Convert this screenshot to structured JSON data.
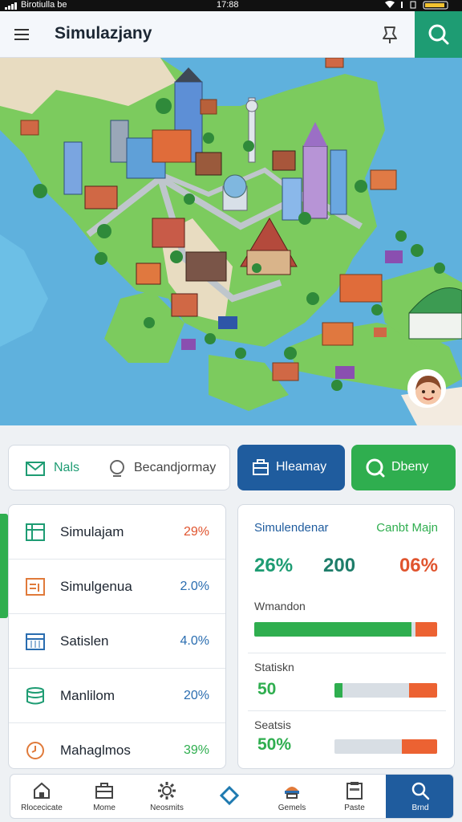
{
  "status_bar": {
    "carrier": "Birotiulla be",
    "time": "17:88"
  },
  "app_bar": {
    "title": "Simulazjany",
    "menu_icon": "menu-icon",
    "pin_icon": "pin-icon",
    "search_icon": "search-icon"
  },
  "actions": {
    "segment": {
      "left_label": "Nals",
      "left_icon": "mail-icon",
      "right_label": "Becandjormay",
      "right_icon": "search-icon"
    },
    "primary": {
      "label": "Hleamay",
      "icon": "briefcase-icon"
    },
    "secondary": {
      "label": "Dbeny",
      "icon": "search-icon"
    }
  },
  "list": [
    {
      "name": "Simulajam",
      "value": "29%",
      "color": "#e0542e",
      "icon": "map-icon"
    },
    {
      "name": "Simulgenua",
      "value": "2.0%",
      "color": "#2a6db0",
      "icon": "document-icon"
    },
    {
      "name": "Satislen",
      "value": "4.0%",
      "color": "#2a6db0",
      "icon": "calendar-icon"
    },
    {
      "name": "Manlilom",
      "value": "20%",
      "color": "#2a6db0",
      "icon": "database-icon"
    },
    {
      "name": "Mahaglmos",
      "value": "39%",
      "color": "#2fae4f",
      "icon": "clock-icon"
    }
  ],
  "stats": {
    "header_left": "Simulendenar",
    "header_right": "Canbt Majn",
    "big_numbers": [
      {
        "value": "26%",
        "color": "#1e9c73"
      },
      {
        "value": "200",
        "color": "#1e7d6a"
      },
      {
        "value": "06%",
        "color": "#e0542e"
      }
    ],
    "sections": [
      {
        "label": "Wmandon",
        "value": "",
        "green_fraction": 0.86,
        "orange_fraction": 0.12
      },
      {
        "label": "Statiskn",
        "value": "50",
        "green_fraction": 0.08,
        "orange_fraction": 0.27
      },
      {
        "label": "Seatsis",
        "value": "50%",
        "green_fraction": 0.0,
        "orange_fraction": 0.34
      }
    ]
  },
  "tabs": [
    {
      "label": "Rlocecicate",
      "icon": "home-icon",
      "active": false
    },
    {
      "label": "Mome",
      "icon": "briefcase-icon",
      "active": false
    },
    {
      "label": "Neosmits",
      "icon": "gear-icon",
      "active": false
    },
    {
      "label": "",
      "icon": "diamond-icon",
      "active": false
    },
    {
      "label": "Gemels",
      "icon": "hat-icon",
      "active": false
    },
    {
      "label": "Paste",
      "icon": "clipboard-icon",
      "active": false
    },
    {
      "label": "Brnd",
      "icon": "search-icon",
      "active": true
    }
  ]
}
